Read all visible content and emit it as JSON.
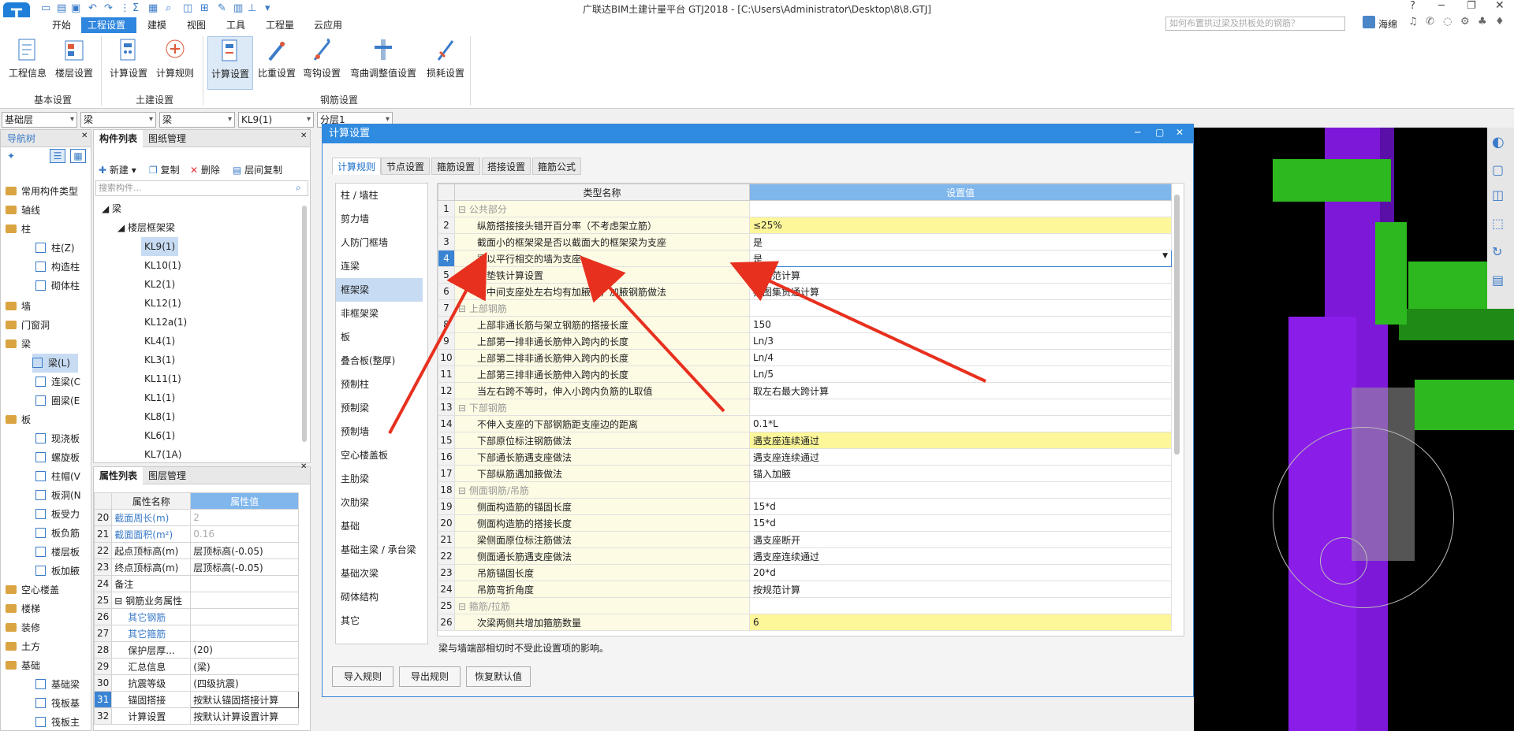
{
  "app": {
    "title": "广联达BIM土建计量平台 GTJ2018 - [C:\\Users\\Administrator\\Desktop\\8\\8.GTJ]",
    "search_placeholder": "如何布置拱过梁及拱板处的钢筋？",
    "user": "海绵",
    "logo": "T"
  },
  "menu": [
    "开始",
    "工程设置",
    "建模",
    "视图",
    "工具",
    "工程量",
    "云应用"
  ],
  "ribbon": {
    "buttons": [
      "工程信息",
      "楼层设置",
      "计算设置",
      "计算规则",
      "计算设置",
      "比重设置",
      "弯钩设置",
      "弯曲调整值设置",
      "损耗设置"
    ],
    "groups": [
      "基本设置",
      "土建设置",
      "钢筋设置"
    ]
  },
  "selectors": [
    "基础层",
    "梁",
    "梁",
    "KL9(1)",
    "分层1"
  ],
  "nav": {
    "title": "导航树",
    "items": [
      "常用构件类型",
      "轴线",
      "柱",
      "墙",
      "门窗洞",
      "梁",
      "板",
      "空心楼盖",
      "楼梯",
      "装修",
      "土方",
      "基础"
    ],
    "subs": [
      "柱(Z)",
      "构造柱",
      "砌体柱",
      "梁(L)",
      "连梁(C",
      "圈梁(E",
      "现浇板",
      "螺旋板",
      "柱帽(V",
      "板洞(N",
      "板受力",
      "板负筋",
      "楼层板",
      "板加腋",
      "基础梁",
      "筏板基",
      "筏板主"
    ]
  },
  "comp": {
    "tabs": [
      "构件列表",
      "图纸管理"
    ],
    "tools": [
      "新建",
      "复制",
      "删除",
      "层间复制"
    ],
    "search_placeholder": "搜索构件...",
    "root": "梁",
    "group": "楼层框架梁",
    "items": [
      "KL9(1)",
      "KL10(1)",
      "KL2(1)",
      "KL12(1)",
      "KL12a(1)",
      "KL4(1)",
      "KL3(1)",
      "KL11(1)",
      "KL1(1)",
      "KL8(1)",
      "KL6(1)",
      "KL7(1A)"
    ]
  },
  "props": {
    "tabs": [
      "属性列表",
      "图层管理"
    ],
    "headers": [
      "属性名称",
      "属性值"
    ],
    "rows": [
      {
        "n": "20",
        "k": "截面周长(m)",
        "v": "2"
      },
      {
        "n": "21",
        "k": "截面面积(m²)",
        "v": "0.16"
      },
      {
        "n": "22",
        "k": "起点顶标高(m)",
        "v": "层顶标高(-0.05)"
      },
      {
        "n": "23",
        "k": "终点顶标高(m)",
        "v": "层顶标高(-0.05)"
      },
      {
        "n": "24",
        "k": "备注",
        "v": ""
      },
      {
        "n": "25",
        "k": "钢筋业务属性",
        "v": ""
      },
      {
        "n": "26",
        "k": "其它钢筋",
        "v": ""
      },
      {
        "n": "27",
        "k": "其它箍筋",
        "v": ""
      },
      {
        "n": "28",
        "k": "保护层厚...",
        "v": "(20)"
      },
      {
        "n": "29",
        "k": "汇总信息",
        "v": "(梁)"
      },
      {
        "n": "30",
        "k": "抗震等级",
        "v": "(四级抗震)"
      },
      {
        "n": "31",
        "k": "锚固搭接",
        "v": "按默认锚固搭接计算"
      },
      {
        "n": "32",
        "k": "计算设置",
        "v": "按默认计算设置计算"
      }
    ]
  },
  "dialog": {
    "title": "计算设置",
    "tabs": [
      "计算规则",
      "节点设置",
      "箍筋设置",
      "搭接设置",
      "箍筋公式"
    ],
    "categories": [
      "柱 / 墙柱",
      "剪力墙",
      "人防门框墙",
      "连梁",
      "框架梁",
      "非框架梁",
      "板",
      "叠合板(整厚)",
      "预制柱",
      "预制梁",
      "预制墙",
      "空心楼盖板",
      "主肋梁",
      "次肋梁",
      "基础",
      "基础主梁 / 承台梁",
      "基础次梁",
      "砌体结构",
      "其它"
    ],
    "headers": [
      "类型名称",
      "设置值"
    ],
    "rows": [
      {
        "n": "1",
        "k": "公共部分",
        "v": "",
        "g": true
      },
      {
        "n": "2",
        "k": "纵筋搭接接头错开百分率（不考虑架立筋）",
        "v": "≤25%",
        "h": true
      },
      {
        "n": "3",
        "k": "截面小的框架梁是否以截面大的框架梁为支座",
        "v": "是"
      },
      {
        "n": "4",
        "k": "梁以平行相交的墙为支座",
        "v": "是"
      },
      {
        "n": "5",
        "k": "梁垫铁计算设置",
        "v": "按规范计算"
      },
      {
        "n": "6",
        "k": "梁中间支座处左右均有加腋时，加腋钢筋做法",
        "v": "按图集贯通计算"
      },
      {
        "n": "7",
        "k": "上部钢筋",
        "v": "",
        "g": true
      },
      {
        "n": "8",
        "k": "上部非通长筋与架立钢筋的搭接长度",
        "v": "150"
      },
      {
        "n": "9",
        "k": "上部第一排非通长筋伸入跨内的长度",
        "v": "Ln/3"
      },
      {
        "n": "10",
        "k": "上部第二排非通长筋伸入跨内的长度",
        "v": "Ln/4"
      },
      {
        "n": "11",
        "k": "上部第三排非通长筋伸入跨内的长度",
        "v": "Ln/5"
      },
      {
        "n": "12",
        "k": "当左右跨不等时，伸入小跨内负筋的L取值",
        "v": "取左右最大跨计算"
      },
      {
        "n": "13",
        "k": "下部钢筋",
        "v": "",
        "g": true
      },
      {
        "n": "14",
        "k": "不伸入支座的下部钢筋距支座边的距离",
        "v": "0.1*L"
      },
      {
        "n": "15",
        "k": "下部原位标注钢筋做法",
        "v": "遇支座连续通过",
        "h": true
      },
      {
        "n": "16",
        "k": "下部通长筋遇支座做法",
        "v": "遇支座连续通过"
      },
      {
        "n": "17",
        "k": "下部纵筋遇加腋做法",
        "v": "锚入加腋"
      },
      {
        "n": "18",
        "k": "侧面钢筋/吊筋",
        "v": "",
        "g": true
      },
      {
        "n": "19",
        "k": "侧面构造筋的锚固长度",
        "v": "15*d"
      },
      {
        "n": "20",
        "k": "侧面构造筋的搭接长度",
        "v": "15*d"
      },
      {
        "n": "21",
        "k": "梁侧面原位标注筋做法",
        "v": "遇支座断开"
      },
      {
        "n": "22",
        "k": "侧面通长筋遇支座做法",
        "v": "遇支座连续通过"
      },
      {
        "n": "23",
        "k": "吊筋锚固长度",
        "v": "20*d"
      },
      {
        "n": "24",
        "k": "吊筋弯折角度",
        "v": "按规范计算"
      },
      {
        "n": "25",
        "k": "箍筋/拉筋",
        "v": "",
        "g": true
      },
      {
        "n": "26",
        "k": "次梁两侧共增加箍筋数量",
        "v": "6",
        "h": true
      }
    ],
    "note": "梁与墙端部相切时不受此设置项的影响。",
    "buttons": [
      "导入规则",
      "导出规则",
      "恢复默认值"
    ]
  },
  "colors": {
    "accent": "#2f8be0",
    "highlight": "#fdf79a",
    "arrow": "#e8301f",
    "purple": "#8a1de8",
    "green": "#2db81f"
  }
}
